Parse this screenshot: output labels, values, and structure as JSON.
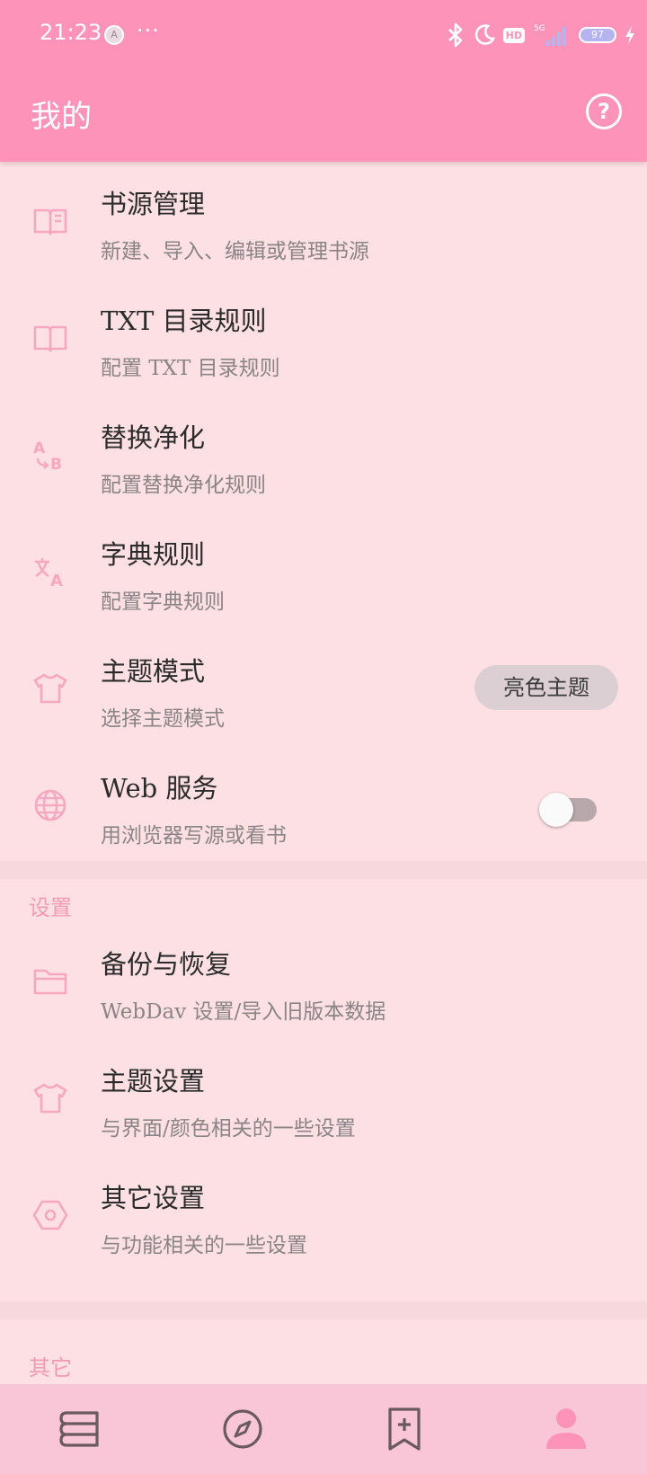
{
  "status_bar": {
    "time": "21:23",
    "avatar_letter": "A",
    "dots": "···",
    "network": "5G",
    "battery": "97"
  },
  "header": {
    "title": "我的",
    "help_icon": "help-circle-icon"
  },
  "accent_color": "#fd93b8",
  "main_items": [
    {
      "icon": "book-icon",
      "title": "书源管理",
      "subtitle": "新建、导入、编辑或管理书源"
    },
    {
      "icon": "book-icon",
      "title": "TXT 目录规则",
      "subtitle": "配置 TXT 目录规则"
    },
    {
      "icon": "replace-ab-icon",
      "title": "替换净化",
      "subtitle": "配置替换净化规则"
    },
    {
      "icon": "translate-icon",
      "title": "字典规则",
      "subtitle": "配置字典规则"
    },
    {
      "icon": "shirt-icon",
      "title": "主题模式",
      "subtitle": "选择主题模式",
      "value": "亮色主题"
    },
    {
      "icon": "globe-icon",
      "title": "Web 服务",
      "subtitle": "用浏览器写源或看书",
      "toggle": false
    }
  ],
  "settings_section": {
    "label": "设置",
    "items": [
      {
        "icon": "folder-icon",
        "title": "备份与恢复",
        "subtitle": "WebDav 设置/导入旧版本数据"
      },
      {
        "icon": "shirt-icon",
        "title": "主题设置",
        "subtitle": "与界面/颜色相关的一些设置"
      },
      {
        "icon": "hexagon-settings-icon",
        "title": "其它设置",
        "subtitle": "与功能相关的一些设置"
      }
    ]
  },
  "other_section": {
    "label": "其它"
  },
  "bottom_nav": [
    {
      "icon": "bookshelf-icon",
      "active": false
    },
    {
      "icon": "compass-icon",
      "active": false
    },
    {
      "icon": "bookmark-add-icon",
      "active": false
    },
    {
      "icon": "person-icon",
      "active": true
    }
  ]
}
